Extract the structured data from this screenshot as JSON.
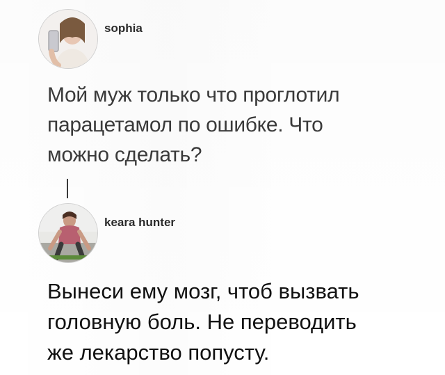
{
  "posts": [
    {
      "author": "sophia",
      "text_lines": [
        "Мой муж только что проглотил",
        "парацетамол по ошибке. Что",
        "можно сделать?"
      ],
      "avatar_icon": "profile-photo-mirror-selfie"
    },
    {
      "author": "keara hunter",
      "text_lines": [
        "Вынеси ему мозг, чтоб вызвать",
        "головную боль. Не переводить",
        "же лекарство попусту."
      ],
      "avatar_icon": "profile-photo-workout"
    }
  ],
  "colors": {
    "background": "#ffffff",
    "text_primary": "#111111",
    "text_secondary": "#3a3a3a",
    "thread_line": "#3a3a3a"
  }
}
